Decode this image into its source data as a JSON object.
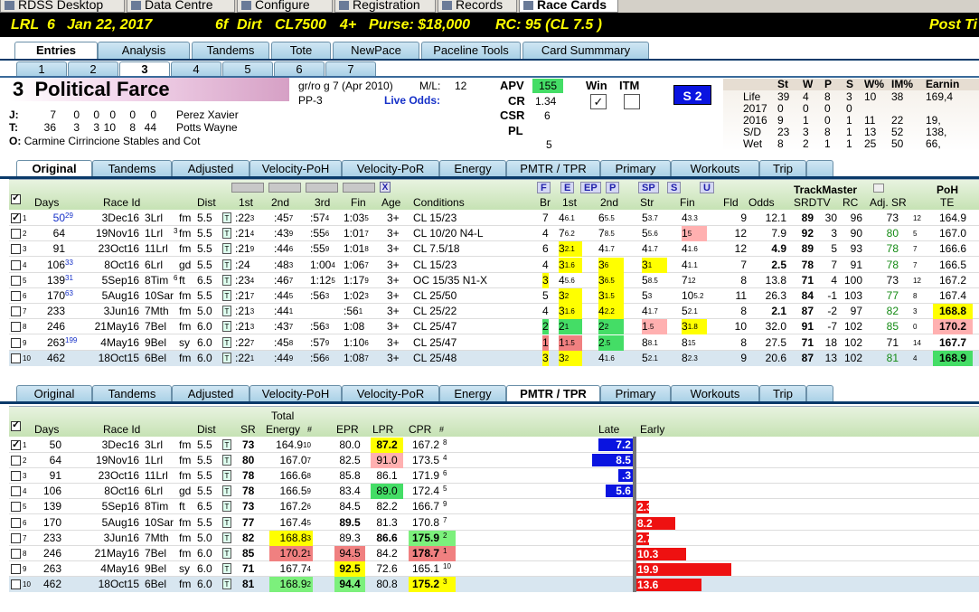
{
  "app_tabs": [
    {
      "label": "RDSS Desktop",
      "icon": "desktop-icon"
    },
    {
      "label": "Data Centre",
      "icon": "data-icon"
    },
    {
      "label": "Configure",
      "icon": "gear-icon"
    },
    {
      "label": "Registration",
      "icon": "registration-icon"
    },
    {
      "label": "Records",
      "icon": "records-icon"
    },
    {
      "label": "Race Cards",
      "icon": "card-icon",
      "active": true
    }
  ],
  "race_header": {
    "track": "LRL",
    "race": "6",
    "date": "Jan 22, 2017",
    "distance": "6f",
    "surface": "Dirt",
    "class": "CL7500",
    "age": "4+",
    "purse": "Purse: $18,000",
    "rc": "RC: 95 (CL 7.5 )",
    "post": "Post Ti"
  },
  "main_tabs": [
    "Entries",
    "Analysis",
    "Tandems",
    "Tote",
    "NewPace",
    "Paceline Tools",
    "Card Summmary"
  ],
  "horse_tabs": [
    "1",
    "2",
    "3",
    "4",
    "5",
    "6",
    "7"
  ],
  "horse": {
    "number": "3",
    "name": "Political Farce",
    "desc": "gr/ro g 7  (Apr 2010)",
    "pp": "PP-3",
    "ml_label": "M/L:",
    "ml_value": "12",
    "live_odds_label": "Live Odds:",
    "jockey": {
      "prefix": "J:",
      "stats": [
        "7",
        "0",
        "0",
        "0",
        "0",
        "0"
      ],
      "name": "Perez Xavier"
    },
    "trainer": {
      "prefix": "T:",
      "stats": [
        "36",
        "3",
        "3",
        "10",
        "8",
        "44"
      ],
      "name": "Potts Wayne"
    },
    "owner": {
      "prefix": "O:",
      "name": "Carmine Cirrincione Stables and Cot"
    },
    "apv_label": "APV",
    "apv": "155",
    "cr_label": "CR",
    "cr": "1.34",
    "csr_label": "CSR",
    "csr": "6",
    "pl_label": "PL",
    "pl": "",
    "extra": "5",
    "win_label": "Win",
    "itm_label": "ITM",
    "s2_label": "S 2"
  },
  "record": {
    "headers": [
      "St",
      "W",
      "P",
      "S",
      "W%",
      "IM%",
      "Earnin"
    ],
    "rows": [
      {
        "label": "Life",
        "v": [
          "39",
          "4",
          "8",
          "3",
          "10",
          "38",
          "169,4"
        ]
      },
      {
        "label": "2017",
        "v": [
          "0",
          "0",
          "0",
          "0",
          "",
          "",
          ""
        ]
      },
      {
        "label": "2016",
        "v": [
          "9",
          "1",
          "0",
          "1",
          "11",
          "22",
          "19,"
        ]
      },
      {
        "label": "S/D",
        "v": [
          "23",
          "3",
          "8",
          "1",
          "13",
          "52",
          "138,"
        ]
      },
      {
        "label": "Wet",
        "v": [
          "8",
          "2",
          "1",
          "1",
          "25",
          "50",
          "66,"
        ]
      }
    ]
  },
  "pp_tabs": [
    "Original",
    "Tandems",
    "Adjusted",
    "Velocity-PoH",
    "Velocity-PoR",
    "Energy",
    "PMTR / TPR",
    "Primary",
    "Workouts",
    "Trip"
  ],
  "pp_headers": {
    "days": "Days",
    "raceid": "Race Id",
    "dist": "Dist",
    "c1": "1st",
    "c2": "2nd",
    "c3": "3rd",
    "fin": "Fin",
    "age": "Age",
    "cond": "Conditions",
    "br": "Br",
    "p1": "1st",
    "p2": "2nd",
    "str": "Str",
    "pfin": "Fin",
    "fld": "Fld",
    "odds": "Odds",
    "tm": "TrackMaster",
    "srdtv": "SRDTV",
    "rc": "RC",
    "adjsr": "Adj. SR",
    "poh": "PoH",
    "te": "TE",
    "btn_x": "X",
    "btn_f": "F",
    "btn_e": "E",
    "btn_ep": "EP",
    "btn_p": "P",
    "btn_sp": "SP",
    "btn_s": "S",
    "btn_u": "U"
  },
  "pp_rows": [
    {
      "n": "1",
      "days": "50",
      "dsup": "29",
      "date": "3Dec16",
      "rn": "3Lrl",
      "sup": "",
      "cond_s": "fm",
      "dist": "5.5",
      "t1": ":22",
      "t1s": "3",
      "t2": ":45",
      "t2s": "7",
      "t3": ":57",
      "t3s": "4",
      "fin": "1:03",
      "fins": "5",
      "age": "3+",
      "cond": "CL 15/23",
      "br": "7",
      "p1": "4",
      "p1s": "6.1",
      "p2": "6",
      "p2s": "5.5",
      "str": "5",
      "strs": "3.7",
      "pf": "4",
      "pfs": "3.3",
      "fld": "9",
      "odds": "12.1",
      "sr": "89",
      "dtv": "30",
      "rc": "96",
      "adj": "73",
      "adjs": "12",
      "poh": "164.9",
      "checked": true
    },
    {
      "n": "2",
      "days": "64",
      "dsup": "",
      "date": "19Nov16",
      "rn": "1Lrl",
      "sup": "3",
      "cond_s": "fm",
      "dist": "5.5",
      "t1": ":21",
      "t1s": "4",
      "t2": ":43",
      "t2s": "9",
      "t3": ":55",
      "t3s": "6",
      "fin": "1:01",
      "fins": "7",
      "age": "3+",
      "cond": "CL 10/20 N4-L",
      "br": "4",
      "p1": "7",
      "p1s": "6.2",
      "p2": "7",
      "p2s": "8.5",
      "str": "5",
      "strs": "5.6",
      "pf": "1",
      "pfs": "5",
      "fld": "12",
      "odds": "7.9",
      "sr": "92",
      "dtv": "3",
      "rc": "90",
      "adj": "80",
      "adjs": "5",
      "poh": "167.0"
    },
    {
      "n": "3",
      "days": "91",
      "dsup": "",
      "date": "23Oct16",
      "rn": "11Lrl",
      "sup": "",
      "cond_s": "fm",
      "dist": "5.5",
      "t1": ":21",
      "t1s": "9",
      "t2": ":44",
      "t2s": "6",
      "t3": ":55",
      "t3s": "9",
      "fin": "1:01",
      "fins": "8",
      "age": "3+",
      "cond": "CL 7.5/18",
      "br": "6",
      "p1": "3",
      "p1s": "2.1",
      "p2": "4",
      "p2s": "1.7",
      "str": "4",
      "strs": "1.7",
      "pf": "4",
      "pfs": "1.6",
      "fld": "12",
      "odds": "4.9",
      "sr": "89",
      "dtv": "5",
      "rc": "93",
      "adj": "78",
      "adjs": "7",
      "poh": "166.6"
    },
    {
      "n": "4",
      "days": "106",
      "dsup": "33",
      "date": "8Oct16",
      "rn": "6Lrl",
      "sup": "",
      "cond_s": "gd",
      "dist": "5.5",
      "t1": ":24",
      "t1s": "",
      "t2": ":48",
      "t2s": "3",
      "t3": "1:00",
      "t3s": "4",
      "fin": "1:06",
      "fins": "7",
      "age": "3+",
      "cond": "CL 15/23",
      "br": "4",
      "p1": "3",
      "p1s": "1.6",
      "p2": "3",
      "p2s": "6",
      "str": "3",
      "strs": "1",
      "pf": "4",
      "pfs": "1.1",
      "fld": "7",
      "odds": "2.5",
      "sr": "78",
      "dtv": "7",
      "rc": "91",
      "adj": "78",
      "adjs": "7",
      "poh": "166.5"
    },
    {
      "n": "5",
      "days": "139",
      "dsup": "31",
      "date": "5Sep16",
      "rn": "8Tim",
      "sup": "6",
      "cond_s": "ft",
      "dist": "6.5",
      "t1": ":23",
      "t1s": "4",
      "t2": ":46",
      "t2s": "7",
      "t3": "1:12",
      "t3s": "5",
      "fin": "1:17",
      "fins": "9",
      "age": "3+",
      "cond": "OC 15/35 N1-X",
      "br": "3",
      "p1": "4",
      "p1s": "5.6",
      "p2": "3",
      "p2s": "6.5",
      "str": "5",
      "strs": "8.5",
      "pf": "7",
      "pfs": "12",
      "fld": "8",
      "odds": "13.8",
      "sr": "71",
      "dtv": "4",
      "rc": "100",
      "adj": "73",
      "adjs": "12",
      "poh": "167.2"
    },
    {
      "n": "6",
      "days": "170",
      "dsup": "63",
      "date": "5Aug16",
      "rn": "10Sar",
      "sup": "",
      "cond_s": "fm",
      "dist": "5.5",
      "t1": ":21",
      "t1s": "7",
      "t2": ":44",
      "t2s": "5",
      "t3": ":56",
      "t3s": "3",
      "fin": "1:02",
      "fins": "3",
      "age": "3+",
      "cond": "CL 25/50",
      "br": "5",
      "p1": "3",
      "p1s": "2",
      "p2": "3",
      "p2s": "1.5",
      "str": "5",
      "strs": "3",
      "pf": "10",
      "pfs": "5.2",
      "fld": "11",
      "odds": "26.3",
      "sr": "84",
      "dtv": "-1",
      "rc": "103",
      "adj": "77",
      "adjs": "8",
      "poh": "167.4"
    },
    {
      "n": "7",
      "days": "233",
      "dsup": "",
      "date": "3Jun16",
      "rn": "7Mth",
      "sup": "",
      "cond_s": "fm",
      "dist": "5.0",
      "t1": ":21",
      "t1s": "3",
      "t2": ":44",
      "t2s": "1",
      "t3": "",
      "t3s": "",
      "fin": ":56",
      "fins": "1",
      "age": "3+",
      "cond": "CL 25/22",
      "br": "4",
      "p1": "3",
      "p1s": "1.6",
      "p2": "4",
      "p2s": "2.2",
      "str": "4",
      "strs": "1.7",
      "pf": "5",
      "pfs": "2.1",
      "fld": "8",
      "odds": "2.1",
      "sr": "87",
      "dtv": "-2",
      "rc": "97",
      "adj": "82",
      "adjs": "3",
      "poh": "168.8"
    },
    {
      "n": "8",
      "days": "246",
      "dsup": "",
      "date": "21May16",
      "rn": "7Bel",
      "sup": "",
      "cond_s": "fm",
      "dist": "6.0",
      "t1": ":21",
      "t1s": "3",
      "t2": ":43",
      "t2s": "7",
      "t3": ":56",
      "t3s": "3",
      "fin": "1:08",
      "fins": "",
      "age": "3+",
      "cond": "CL 25/47",
      "br": "2",
      "p1": "2",
      "p1s": "1",
      "p2": "2",
      "p2s": "2",
      "str": "1",
      "strs": ".5",
      "pf": "3",
      "pfs": "1.8",
      "fld": "10",
      "odds": "32.0",
      "sr": "91",
      "dtv": "-7",
      "rc": "102",
      "adj": "85",
      "adjs": "0",
      "poh": "170.2"
    },
    {
      "n": "9",
      "days": "263",
      "dsup": "199",
      "date": "4May16",
      "rn": "9Bel",
      "sup": "",
      "cond_s": "sy",
      "dist": "6.0",
      "t1": ":22",
      "t1s": "7",
      "t2": ":45",
      "t2s": "8",
      "t3": ":57",
      "t3s": "9",
      "fin": "1:10",
      "fins": "6",
      "age": "3+",
      "cond": "CL 25/47",
      "br": "1",
      "p1": "1",
      "p1s": "1.5",
      "p2": "2",
      "p2s": ".5",
      "str": "8",
      "strs": "8.1",
      "pf": "8",
      "pfs": "15",
      "fld": "8",
      "odds": "27.5",
      "sr": "71",
      "dtv": "18",
      "rc": "102",
      "adj": "71",
      "adjs": "14",
      "poh": "167.7"
    },
    {
      "n": "10",
      "days": "462",
      "dsup": "",
      "date": "18Oct15",
      "rn": "6Bel",
      "sup": "",
      "cond_s": "fm",
      "dist": "6.0",
      "t1": ":22",
      "t1s": "1",
      "t2": ":44",
      "t2s": "9",
      "t3": ":56",
      "t3s": "6",
      "fin": "1:08",
      "fins": "7",
      "age": "3+",
      "cond": "CL 25/48",
      "br": "3",
      "p1": "3",
      "p1s": "2",
      "p2": "4",
      "p2s": "1.6",
      "str": "5",
      "strs": "2.1",
      "pf": "8",
      "pfs": "2.3",
      "fld": "9",
      "odds": "20.6",
      "sr": "87",
      "dtv": "13",
      "rc": "102",
      "adj": "81",
      "adjs": "4",
      "poh": "168.9"
    }
  ],
  "pm_headers": {
    "days": "Days",
    "raceid": "Race Id",
    "dist": "Dist",
    "sr": "SR",
    "total": "Total",
    "energy": "Energy",
    "hash": "#",
    "epr": "EPR",
    "lpr": "LPR",
    "cpr": "CPR",
    "late": "Late",
    "early": "Early"
  },
  "pm_rows": [
    {
      "n": "1",
      "days": "50",
      "date": "3Dec16",
      "rn": "3Lrl",
      "cond_s": "fm",
      "dist": "5.5",
      "sr": "73",
      "te": "164.9",
      "tes": "10",
      "epr": "80.0",
      "lpr": "87.2",
      "cpr": "167.2",
      "cprs": "8",
      "bar": "7.2",
      "dir": "late",
      "val": 7.2,
      "checked": true
    },
    {
      "n": "2",
      "days": "64",
      "date": "19Nov16",
      "rn": "1Lrl",
      "cond_s": "fm",
      "dist": "5.5",
      "sr": "80",
      "te": "167.0",
      "tes": "7",
      "epr": "82.5",
      "lpr": "91.0",
      "cpr": "173.5",
      "cprs": "4",
      "bar": "8.5",
      "dir": "late",
      "val": 8.5
    },
    {
      "n": "3",
      "days": "91",
      "date": "23Oct16",
      "rn": "11Lrl",
      "cond_s": "fm",
      "dist": "5.5",
      "sr": "78",
      "te": "166.6",
      "tes": "8",
      "epr": "85.8",
      "lpr": "86.1",
      "cpr": "171.9",
      "cprs": "6",
      "bar": ".3",
      "dir": "late",
      "val": 0.3
    },
    {
      "n": "4",
      "days": "106",
      "date": "8Oct16",
      "rn": "6Lrl",
      "cond_s": "gd",
      "dist": "5.5",
      "sr": "78",
      "te": "166.5",
      "tes": "9",
      "epr": "83.4",
      "lpr": "89.0",
      "cpr": "172.4",
      "cprs": "5",
      "bar": "5.6",
      "dir": "late",
      "val": 5.6
    },
    {
      "n": "5",
      "days": "139",
      "date": "5Sep16",
      "rn": "8Tim",
      "cond_s": "ft",
      "dist": "6.5",
      "sr": "73",
      "te": "167.2",
      "tes": "6",
      "epr": "84.5",
      "lpr": "82.2",
      "cpr": "166.7",
      "cprs": "9",
      "bar": "2.3",
      "dir": "early",
      "val": 2.3
    },
    {
      "n": "6",
      "days": "170",
      "date": "5Aug16",
      "rn": "10Sar",
      "cond_s": "fm",
      "dist": "5.5",
      "sr": "77",
      "te": "167.4",
      "tes": "5",
      "epr": "89.5",
      "lpr": "81.3",
      "cpr": "170.8",
      "cprs": "7",
      "bar": "8.2",
      "dir": "early",
      "val": 8.2
    },
    {
      "n": "7",
      "days": "233",
      "date": "3Jun16",
      "rn": "7Mth",
      "cond_s": "fm",
      "dist": "5.0",
      "sr": "82",
      "te": "168.8",
      "tes": "3",
      "epr": "89.3",
      "lpr": "86.6",
      "cpr": "175.9",
      "cprs": "2",
      "bar": "2.7",
      "dir": "early",
      "val": 2.7
    },
    {
      "n": "8",
      "days": "246",
      "date": "21May16",
      "rn": "7Bel",
      "cond_s": "fm",
      "dist": "6.0",
      "sr": "85",
      "te": "170.2",
      "tes": "1",
      "epr": "94.5",
      "lpr": "84.2",
      "cpr": "178.7",
      "cprs": "1",
      "bar": "10.3",
      "dir": "early",
      "val": 10.3
    },
    {
      "n": "9",
      "days": "263",
      "date": "4May16",
      "rn": "9Bel",
      "cond_s": "sy",
      "dist": "6.0",
      "sr": "71",
      "te": "167.7",
      "tes": "4",
      "epr": "92.5",
      "lpr": "72.6",
      "cpr": "165.1",
      "cprs": "10",
      "bar": "19.9",
      "dir": "early",
      "val": 19.9
    },
    {
      "n": "10",
      "days": "462",
      "date": "18Oct15",
      "rn": "6Bel",
      "cond_s": "fm",
      "dist": "6.0",
      "sr": "81",
      "te": "168.9",
      "tes": "2",
      "epr": "94.4",
      "lpr": "80.8",
      "cpr": "175.2",
      "cprs": "3",
      "bar": "13.6",
      "dir": "early",
      "val": 13.6
    }
  ]
}
